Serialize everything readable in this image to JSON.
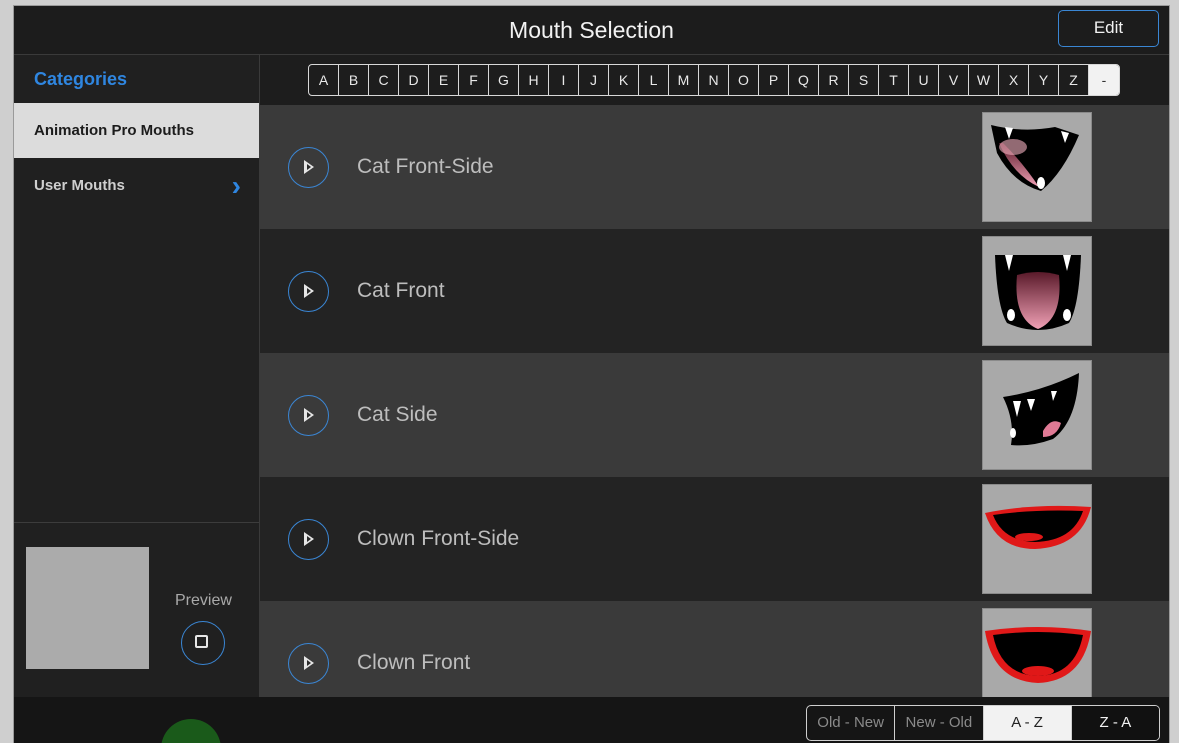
{
  "header": {
    "title": "Mouth Selection",
    "edit_label": "Edit"
  },
  "sidebar": {
    "title": "Categories",
    "items": [
      {
        "label": "Animation Pro Mouths",
        "selected": true
      },
      {
        "label": "User Mouths",
        "has_chevron": true
      }
    ],
    "preview_label": "Preview"
  },
  "alphabet": [
    "A",
    "B",
    "C",
    "D",
    "E",
    "F",
    "G",
    "H",
    "I",
    "J",
    "K",
    "L",
    "M",
    "N",
    "O",
    "P",
    "Q",
    "R",
    "S",
    "T",
    "U",
    "V",
    "W",
    "X",
    "Y",
    "Z",
    "-"
  ],
  "list": [
    {
      "label": "Cat Front-Side",
      "thumb": "cat-front-side-mouth"
    },
    {
      "label": "Cat Front",
      "thumb": "cat-front-mouth"
    },
    {
      "label": "Cat Side",
      "thumb": "cat-side-mouth"
    },
    {
      "label": "Clown Front-Side",
      "thumb": "clown-front-side-mouth"
    },
    {
      "label": "Clown Front",
      "thumb": "clown-front-mouth"
    }
  ],
  "sort": {
    "options": [
      "Old - New",
      "New - Old",
      "A - Z",
      "Z - A"
    ],
    "selected": "A - Z"
  },
  "colors": {
    "accent": "#3a86d4",
    "category_title": "#2f86e0",
    "clown_red": "#e01818",
    "tongue_pink": "#e07a95"
  }
}
